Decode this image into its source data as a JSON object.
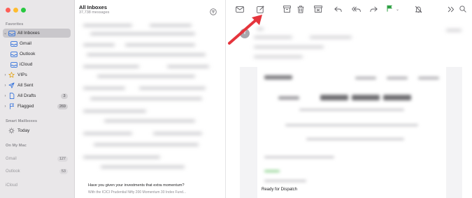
{
  "window": {
    "controls": [
      "close",
      "minimize",
      "zoom"
    ]
  },
  "sidebar": {
    "favorites_label": "Favorites",
    "inboxes": {
      "label": "All Inboxes",
      "selected": true
    },
    "accounts": [
      {
        "label": "Gmail"
      },
      {
        "label": "Outlook"
      },
      {
        "label": "iCloud"
      }
    ],
    "vips": {
      "label": "VIPs"
    },
    "sent": {
      "label": "All Sent"
    },
    "drafts": {
      "label": "All Drafts",
      "count": "3"
    },
    "flagged": {
      "label": "Flagged",
      "count": "269"
    },
    "smart_label": "Smart Mailboxes",
    "today": {
      "label": "Today"
    },
    "onmymac_label": "On My Mac",
    "local": [
      {
        "label": "Gmail",
        "count": "127"
      },
      {
        "label": "Outlook",
        "count": "53"
      },
      {
        "label": "iCloud"
      }
    ]
  },
  "message_list": {
    "title": "All Inboxes",
    "count": "37,738 messages",
    "preview_subject": "Have you given your investments that extra momentum?",
    "preview_snippet": "With the ICICI Prudential Nifty 200 Momentum 30 Index Fund..."
  },
  "toolbar": {
    "icons": [
      "filter-icon",
      "envelope-icon",
      "compose-icon",
      "archive-icon",
      "trash-icon",
      "junk-icon",
      "reply-icon",
      "reply-all-icon",
      "forward-icon",
      "flag-icon",
      "mute-icon",
      "more-icon",
      "search-icon"
    ],
    "flag_color": "#2ea043"
  },
  "reader": {
    "avatar_initial": "T",
    "body_footer": "Ready for Dispatch"
  },
  "colors": {
    "accent": "#2f6fdb",
    "annotation_arrow": "#e5343c"
  }
}
